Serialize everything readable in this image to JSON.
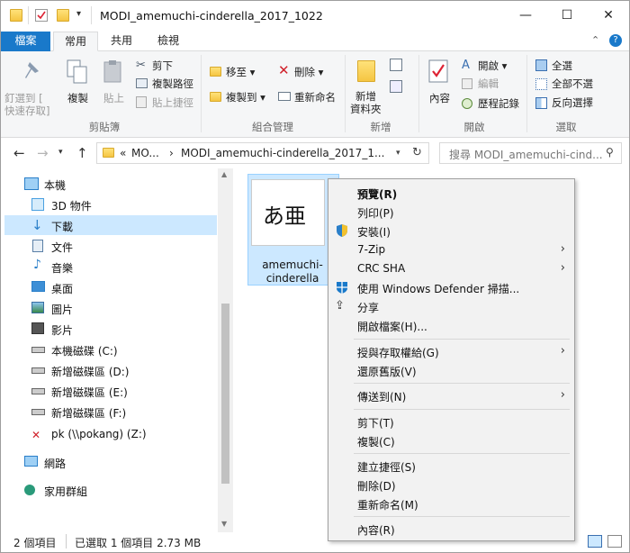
{
  "window": {
    "title": "MODI_amemuchi-cinderella_2017_1022",
    "controls": {
      "minimize": "—",
      "maximize": "☐",
      "close": "✕"
    }
  },
  "ribbon_tabs": [
    {
      "label": "檔案"
    },
    {
      "label": "常用"
    },
    {
      "label": "共用"
    },
    {
      "label": "檢視"
    }
  ],
  "ribbon": {
    "clipboard": {
      "pin": "釘選到 [",
      "pin2": "快速存取]",
      "copy": "複製",
      "paste": "貼上",
      "cut": "剪下",
      "copy_path": "複製路徑",
      "paste_shortcut": "貼上捷徑",
      "group": "剪貼簿"
    },
    "organize": {
      "move_to": "移至",
      "copy_to": "複製到",
      "delete": "刪除",
      "rename": "重新命名",
      "group": "組合管理"
    },
    "new": {
      "new_folder_1": "新增",
      "new_folder_2": "資料夾",
      "group": "新增"
    },
    "open": {
      "properties": "內容",
      "open": "開啟",
      "edit": "編輯",
      "history": "歷程記錄",
      "group": "開啟"
    },
    "select": {
      "select_all": "全選",
      "select_none": "全部不選",
      "invert": "反向選擇",
      "group": "選取"
    }
  },
  "address": {
    "prefix": "«",
    "crumb1": "MO...",
    "sep": "›",
    "crumb2": "MODI_amemuchi-cinderella_2017_1...",
    "search_placeholder": "搜尋 MODI_amemuchi-cind..."
  },
  "nav_pane": [
    {
      "label": "本機"
    },
    {
      "label": "3D 物件"
    },
    {
      "label": "下載"
    },
    {
      "label": "文件"
    },
    {
      "label": "音樂"
    },
    {
      "label": "桌面"
    },
    {
      "label": "圖片"
    },
    {
      "label": "影片"
    },
    {
      "label": "本機磁碟 (C:)"
    },
    {
      "label": "新增磁碟區 (D:)"
    },
    {
      "label": "新增磁碟區 (E:)"
    },
    {
      "label": "新增磁碟區 (F:)"
    },
    {
      "label": "pk (\\\\pokang) (Z:)"
    },
    {
      "label": "網路"
    },
    {
      "label": "家用群組"
    }
  ],
  "file": {
    "name": "amemuchi-cinderella",
    "thumb_text": "あ亜"
  },
  "status": {
    "count": "2 個項目",
    "selected": "已選取 1 個項目 2.73 MB"
  },
  "context_menu": [
    {
      "label": "預覽(R)"
    },
    {
      "label": "列印(P)"
    },
    {
      "label": "安裝(I)"
    },
    {
      "label": "7-Zip"
    },
    {
      "label": "CRC SHA"
    },
    {
      "label": "使用 Windows Defender 掃描..."
    },
    {
      "label": "分享"
    },
    {
      "label": "開啟檔案(H)..."
    },
    {
      "label": "授與存取權給(G)"
    },
    {
      "label": "還原舊版(V)"
    },
    {
      "label": "傳送到(N)"
    },
    {
      "label": "剪下(T)"
    },
    {
      "label": "複製(C)"
    },
    {
      "label": "建立捷徑(S)"
    },
    {
      "label": "刪除(D)"
    },
    {
      "label": "重新命名(M)"
    },
    {
      "label": "內容(R)"
    }
  ],
  "colors": {
    "accent": "#1979ca",
    "selection": "#cce8ff",
    "menu_bg": "#f2f2f2"
  }
}
